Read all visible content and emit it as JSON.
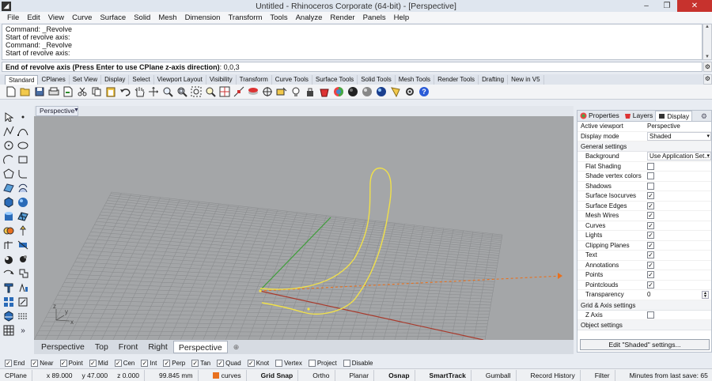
{
  "window": {
    "title": "Untitled - Rhinoceros Corporate (64-bit) - [Perspective]",
    "min": "–",
    "max": "❐",
    "close": "✕"
  },
  "menu": [
    "File",
    "Edit",
    "View",
    "Curve",
    "Surface",
    "Solid",
    "Mesh",
    "Dimension",
    "Transform",
    "Tools",
    "Analyze",
    "Render",
    "Panels",
    "Help"
  ],
  "command_history": [
    "Command: _Revolve",
    "Start of revolve axis:",
    "Command: _Revolve",
    "Start of revolve axis:"
  ],
  "command_prompt": {
    "label": "End of revolve axis (Press Enter to use CPlane z-axis direction)",
    "value": ": 0,0,3"
  },
  "toolbar_tabs": [
    "Standard",
    "CPlanes",
    "Set View",
    "Display",
    "Select",
    "Viewport Layout",
    "Visibility",
    "Transform",
    "Curve Tools",
    "Surface Tools",
    "Solid Tools",
    "Mesh Tools",
    "Render Tools",
    "Drafting",
    "New in V5"
  ],
  "toolbar_icons": [
    "new-icon",
    "open-icon",
    "save-icon",
    "print-icon",
    "import-icon",
    "cut-icon",
    "copy-icon",
    "paste-icon",
    "undo-icon",
    "pan-icon",
    "rotate-view-icon",
    "zoom-dynamic-icon",
    "zoom-window-icon",
    "zoom-extents-icon",
    "zoom-selected-icon",
    "four-viewports-icon",
    "osnap-icon",
    "hide-icon",
    "select-icon",
    "show-icon",
    "light-icon",
    "lock-icon",
    "layer-icon",
    "material-icon",
    "render-icon",
    "shaded-icon",
    "rendered-icon",
    "light-bulb-icon",
    "options-icon",
    "help-icon"
  ],
  "viewport": {
    "name": "Perspective",
    "axis_labels": {
      "x": "x",
      "y": "y",
      "z": "z"
    }
  },
  "viewport_tabs": [
    "Perspective",
    "Top",
    "Front",
    "Right",
    "Perspective"
  ],
  "viewport_add": "⊕",
  "panel": {
    "tabs": [
      "Properties",
      "Layers",
      "Display"
    ],
    "active_viewport_label": "Active viewport",
    "active_viewport_value": "Perspective",
    "display_mode_label": "Display mode",
    "display_mode_value": "Shaded",
    "general_header": "General settings",
    "background_label": "Background",
    "background_value": "Use Application Set...",
    "flags": [
      {
        "label": "Flat Shading",
        "checked": false
      },
      {
        "label": "Shade vertex colors",
        "checked": false
      },
      {
        "label": "Shadows",
        "checked": false
      },
      {
        "label": "Surface Isocurves",
        "checked": true
      },
      {
        "label": "Surface Edges",
        "checked": true
      },
      {
        "label": "Mesh Wires",
        "checked": true
      },
      {
        "label": "Curves",
        "checked": true
      },
      {
        "label": "Lights",
        "checked": true
      },
      {
        "label": "Clipping Planes",
        "checked": true
      },
      {
        "label": "Text",
        "checked": true
      },
      {
        "label": "Annotations",
        "checked": true
      },
      {
        "label": "Points",
        "checked": true
      },
      {
        "label": "Pointclouds",
        "checked": true
      }
    ],
    "transparency_label": "Transparency",
    "transparency_value": "0",
    "grid_header": "Grid & Axis settings",
    "zaxis_label": "Z Axis",
    "zaxis_checked": false,
    "object_header": "Object settings",
    "edit_button": "Edit \"Shaded\" settings..."
  },
  "osnaps": [
    {
      "label": "End",
      "checked": true
    },
    {
      "label": "Near",
      "checked": true
    },
    {
      "label": "Point",
      "checked": true
    },
    {
      "label": "Mid",
      "checked": true
    },
    {
      "label": "Cen",
      "checked": true
    },
    {
      "label": "Int",
      "checked": true
    },
    {
      "label": "Perp",
      "checked": true
    },
    {
      "label": "Tan",
      "checked": true
    },
    {
      "label": "Quad",
      "checked": true
    },
    {
      "label": "Knot",
      "checked": true
    },
    {
      "label": "Vertex",
      "checked": false
    },
    {
      "label": "Project",
      "checked": false
    },
    {
      "label": "Disable",
      "checked": false
    }
  ],
  "status": {
    "cplane": "CPlane",
    "x": "x 89.000",
    "y": "y 47.000",
    "z": "z 0.000",
    "dist": "99.845 mm",
    "layer": "curves",
    "layer_color": "#e8701e",
    "grid_snap": "Grid Snap",
    "ortho": "Ortho",
    "planar": "Planar",
    "osnap": "Osnap",
    "smarttrack": "SmartTrack",
    "gumball": "Gumball",
    "record_history": "Record History",
    "filter": "Filter",
    "minutes": "Minutes from last save: 65"
  },
  "colors": {
    "curve": "#f0e04a",
    "x_axis": "#a83a2c",
    "y_axis": "#3f9e3a",
    "revolve_axis": "#e8701e",
    "grid": "#8c8e90",
    "viewport_bg": "#a4a6a8"
  }
}
